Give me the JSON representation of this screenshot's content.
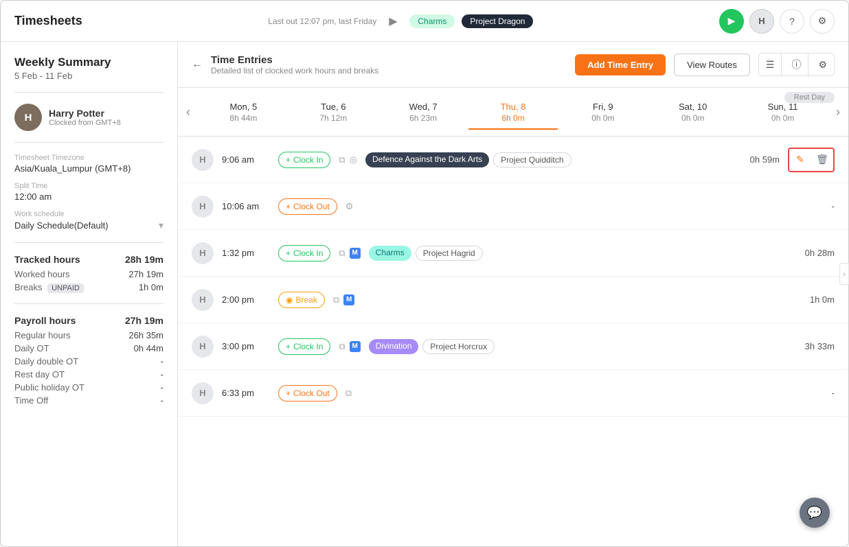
{
  "app": {
    "title": "Timesheets"
  },
  "topbar": {
    "last_out": "Last out 12:07 pm, last Friday",
    "active_badge": "Charms",
    "active_project": "Project Dragon",
    "play_label": "Play",
    "avatar_label": "H",
    "help_label": "?",
    "settings_label": "Settings"
  },
  "sidebar": {
    "weekly_summary_label": "Weekly Summary",
    "date_range": "5 Feb - 11 Feb",
    "user": {
      "name": "Harry Potter",
      "sub": "Clocked from GMT+8",
      "avatar_letter": "H"
    },
    "timezone_label": "Timesheet Timezone",
    "timezone_value": "Asia/Kuala_Lumpur (GMT+8)",
    "split_time_label": "Split Time",
    "split_time_value": "12:00 am",
    "work_schedule_label": "Work schedule",
    "work_schedule_value": "Daily Schedule(Default)",
    "tracked_hours_label": "Tracked hours",
    "tracked_hours_value": "28h 19m",
    "worked_hours_label": "Worked hours",
    "worked_hours_value": "27h 19m",
    "breaks_label": "Breaks",
    "breaks_badge": "UNPAID",
    "breaks_value": "1h 0m",
    "payroll_hours_label": "Payroll hours",
    "payroll_hours_value": "27h 19m",
    "regular_hours_label": "Regular hours",
    "regular_hours_value": "26h 35m",
    "daily_ot_label": "Daily OT",
    "daily_ot_value": "0h 44m",
    "daily_double_ot_label": "Daily double OT",
    "daily_double_ot_value": "-",
    "rest_day_ot_label": "Rest day OT",
    "rest_day_ot_value": "-",
    "public_holiday_ot_label": "Public holiday OT",
    "public_holiday_ot_value": "-",
    "time_off_label": "Time Off",
    "time_off_value": "-"
  },
  "entries": {
    "title": "Time Entries",
    "subtitle": "Detailed list of clocked work hours and breaks",
    "add_button": "Add Time Entry",
    "view_routes_button": "View Routes"
  },
  "days": [
    {
      "name": "Mon, 5",
      "hours": "8h 44m",
      "active": false
    },
    {
      "name": "Tue, 6",
      "hours": "7h 12m",
      "active": false
    },
    {
      "name": "Wed, 7",
      "hours": "6h 23m",
      "active": false
    },
    {
      "name": "Thu, 8",
      "hours": "6h 0m",
      "active": true
    },
    {
      "name": "Fri, 9",
      "hours": "0h 0m",
      "active": false
    },
    {
      "name": "Sat, 10",
      "hours": "0h 0m",
      "active": false,
      "rest": true
    },
    {
      "name": "Sun, 11",
      "hours": "0h 0m",
      "active": false,
      "rest": true
    }
  ],
  "rest_day_label": "Rest Day",
  "time_entries": [
    {
      "id": 1,
      "avatar": "H",
      "time": "9:06 am",
      "type": "Clock In",
      "type_class": "clock-in-btn",
      "has_copy": true,
      "has_location": true,
      "tags": [
        {
          "label": "Defence Against the Dark Arts",
          "class": "tag-dark"
        },
        {
          "label": "Project Quidditch",
          "class": "tag-outline"
        }
      ],
      "duration": "0h 59m",
      "highlighted": true
    },
    {
      "id": 2,
      "avatar": "H",
      "time": "10:06 am",
      "type": "Clock Out",
      "type_class": "clock-out-btn",
      "has_copy": false,
      "has_location": false,
      "has_gear": true,
      "tags": [],
      "duration": "-",
      "highlighted": false
    },
    {
      "id": 3,
      "avatar": "H",
      "time": "1:32 pm",
      "type": "Clock In",
      "type_class": "clock-in-btn",
      "has_copy": true,
      "has_m": true,
      "tags": [
        {
          "label": "Charms",
          "class": "tag-teal"
        },
        {
          "label": "Project Hagrid",
          "class": "tag-outline"
        }
      ],
      "duration": "0h 28m",
      "highlighted": false
    },
    {
      "id": 4,
      "avatar": "H",
      "time": "2:00 pm",
      "type": "Break",
      "type_class": "break-btn",
      "has_copy": true,
      "has_m": true,
      "tags": [],
      "duration": "1h 0m",
      "highlighted": false
    },
    {
      "id": 5,
      "avatar": "H",
      "time": "3:00 pm",
      "type": "Clock In",
      "type_class": "clock-in-btn",
      "has_copy": true,
      "has_m": true,
      "tags": [
        {
          "label": "Divination",
          "class": "tag-purple"
        },
        {
          "label": "Project Horcrux",
          "class": "tag-outline"
        }
      ],
      "duration": "3h 33m",
      "highlighted": false
    },
    {
      "id": 6,
      "avatar": "H",
      "time": "6:33 pm",
      "type": "Clock Out",
      "type_class": "clock-out-btn",
      "has_copy": true,
      "tags": [],
      "duration": "-",
      "highlighted": false
    }
  ]
}
